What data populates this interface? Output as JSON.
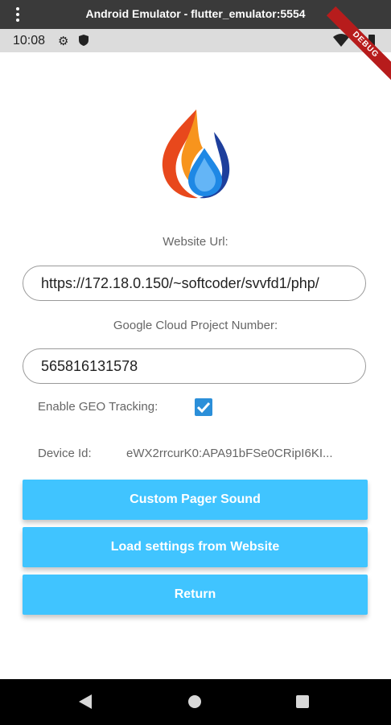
{
  "window": {
    "title": "Android Emulator - flutter_emulator:5554"
  },
  "status_bar": {
    "time": "10:08",
    "icons": [
      "gear-icon",
      "shield-icon",
      "wifi-icon",
      "battery-icon"
    ]
  },
  "debug_banner": "DEBUG",
  "form": {
    "website_url_label": "Website Url:",
    "website_url_value": "https://172.18.0.150/~softcoder/svvfd1/php/",
    "project_number_label": "Google Cloud Project Number:",
    "project_number_value": "565816131578",
    "geo_label": "Enable GEO Tracking:",
    "geo_checked": true,
    "device_id_label": "Device Id:",
    "device_id_value": "eWX2rrcurK0:APA91bFSe0CRipI6KI..."
  },
  "buttons": {
    "custom_sound": "Custom Pager Sound",
    "load_settings": "Load settings from Website",
    "return": "Return"
  },
  "colors": {
    "accent": "#40c4ff",
    "checkbox": "#2b8fd9",
    "debug": "#b71c1c"
  }
}
